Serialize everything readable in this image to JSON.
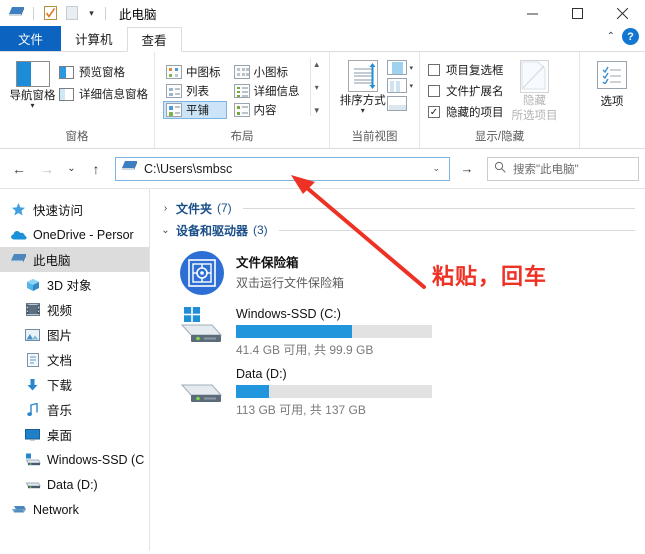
{
  "window": {
    "title": "此电脑",
    "quick_access": [
      {
        "name": "this-pc-icon",
        "label": "此电脑"
      },
      {
        "name": "properties-icon",
        "label": "属性"
      },
      {
        "name": "new-folder-icon",
        "label": "新建文件夹"
      }
    ],
    "controls": {
      "minimize": "–",
      "maximize": "□",
      "close": "✕",
      "collapse_ribbon": "⌃",
      "help": "?"
    }
  },
  "tabs": [
    {
      "label": "文件",
      "state": "file-menu"
    },
    {
      "label": "计算机",
      "state": "inactive"
    },
    {
      "label": "查看",
      "state": "active"
    }
  ],
  "ribbon": {
    "groups": [
      {
        "label": "窗格",
        "big_button": {
          "label": "导航窗格",
          "caret": "▾"
        },
        "items": [
          {
            "label": "预览窗格"
          },
          {
            "label": "详细信息窗格"
          }
        ]
      },
      {
        "label": "布局",
        "views": [
          {
            "label": "中图标",
            "selected": false
          },
          {
            "label": "小图标",
            "selected": false
          },
          {
            "label": "列表",
            "selected": false
          },
          {
            "label": "详细信息",
            "selected": false
          },
          {
            "label": "平铺",
            "selected": true
          },
          {
            "label": "内容",
            "selected": false
          }
        ],
        "scroll": [
          "▲",
          "▾",
          "▼"
        ]
      },
      {
        "label": "当前视图",
        "sort_button": {
          "label": "排序方式",
          "caret": "▾"
        },
        "side_buttons": [
          {
            "name": "add-columns-button",
            "caret": "▾"
          },
          {
            "name": "size-all-columns-button",
            "caret": "▾"
          },
          {
            "name": "current-view-extra-button",
            "caret": ""
          }
        ]
      },
      {
        "label": "显示/隐藏",
        "checkboxes": [
          {
            "label": "项目复选框",
            "checked": false
          },
          {
            "label": "文件扩展名",
            "checked": false
          },
          {
            "label": "隐藏的项目",
            "checked": true
          }
        ],
        "hide_button": {
          "line1": "隐藏",
          "line2": "所选项目",
          "disabled": true
        },
        "options_button": {
          "label": "选项"
        }
      }
    ]
  },
  "address_bar": {
    "back": "←",
    "forward": "→",
    "recent": "⌄",
    "up": "↑",
    "path": "C:\\Users\\smbsc",
    "dropdown_caret": "⌄",
    "go": "→",
    "search_placeholder": "搜索\"此电脑\""
  },
  "sidebar": {
    "items": [
      {
        "label": "快速访问",
        "icon": "star-icon",
        "indent": 0,
        "selected": false
      },
      {
        "label": "OneDrive - Persor",
        "icon": "onedrive-icon",
        "indent": 0,
        "selected": false
      },
      {
        "label": "此电脑",
        "icon": "this-pc-icon",
        "indent": 0,
        "selected": true
      },
      {
        "label": "3D 对象",
        "icon": "3d-objects-icon",
        "indent": 1,
        "selected": false
      },
      {
        "label": "视频",
        "icon": "videos-icon",
        "indent": 1,
        "selected": false
      },
      {
        "label": "图片",
        "icon": "pictures-icon",
        "indent": 1,
        "selected": false
      },
      {
        "label": "文档",
        "icon": "documents-icon",
        "indent": 1,
        "selected": false
      },
      {
        "label": "下载",
        "icon": "downloads-icon",
        "indent": 1,
        "selected": false
      },
      {
        "label": "音乐",
        "icon": "music-icon",
        "indent": 1,
        "selected": false
      },
      {
        "label": "桌面",
        "icon": "desktop-icon",
        "indent": 1,
        "selected": false
      },
      {
        "label": "Windows-SSD (C",
        "icon": "windows-drive-icon",
        "indent": 1,
        "selected": false
      },
      {
        "label": "Data (D:)",
        "icon": "drive-icon",
        "indent": 1,
        "selected": false
      },
      {
        "label": "Network",
        "icon": "network-icon",
        "indent": 0,
        "selected": false
      }
    ]
  },
  "main": {
    "groups": [
      {
        "name": "文件夹",
        "count": "(7)",
        "caret": "›",
        "expanded": false
      },
      {
        "name": "设备和驱动器",
        "count": "(3)",
        "caret": "⌄",
        "expanded": true
      }
    ],
    "tile": {
      "title": "文件保险箱",
      "subtitle": "双击运行文件保险箱",
      "icon": "safe-box-icon"
    },
    "drives": [
      {
        "title": "Windows-SSD (C:)",
        "detail": "41.4 GB 可用, 共 99.9 GB",
        "used_percent": 59,
        "icon": "windows-drive-icon"
      },
      {
        "title": "Data (D:)",
        "detail": "113 GB 可用, 共 137 GB",
        "used_percent": 17,
        "icon": "drive-icon"
      }
    ]
  },
  "annotation": {
    "text": "粘贴，回车",
    "color": "#ed3124"
  },
  "colors": {
    "accent": "#0c64c0",
    "selection": "#cce4f7",
    "progress": "#2196dd",
    "annotation": "#ed3124"
  }
}
